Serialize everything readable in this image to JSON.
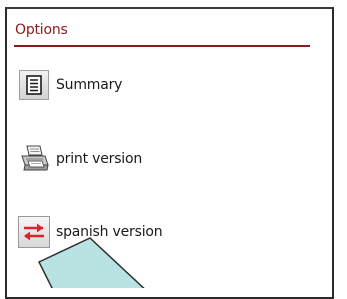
{
  "panel": {
    "title": "Options",
    "accent_color": "#8b1a1a"
  },
  "options": [
    {
      "label": "Summary",
      "icon": "summary-document-icon"
    },
    {
      "label": "print version",
      "icon": "printer-icon"
    },
    {
      "label": "spanish version",
      "icon": "swap-arrows-icon"
    }
  ],
  "callout": {
    "fill_color": "#b9e3e3",
    "stroke_color": "#2e2e2e"
  }
}
